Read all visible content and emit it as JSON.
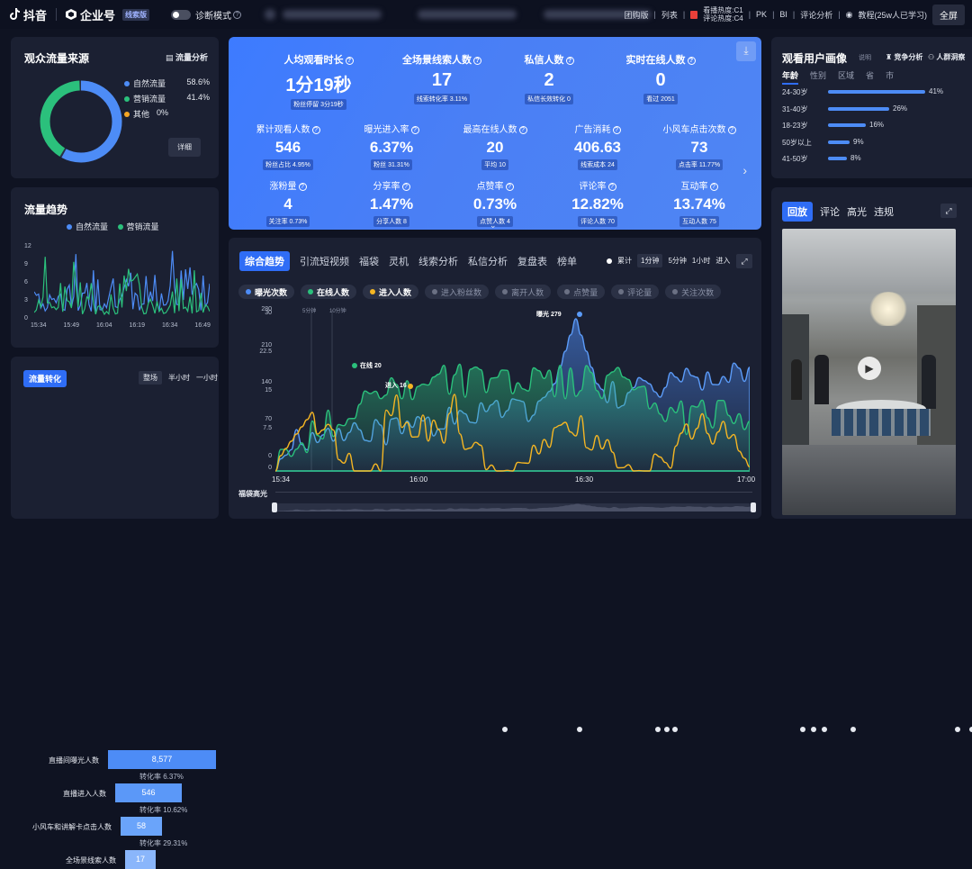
{
  "topbar": {
    "app_name": "抖音",
    "brand": "企业号",
    "brand_tag": "线索版",
    "diag_label": "诊断模式",
    "links": [
      "团购版",
      "列表"
    ],
    "heat_line1": "看播热度:C1",
    "heat_line2": "评论热度:C4",
    "links2": [
      "PK",
      "BI",
      "评论分析"
    ],
    "tutorial": "教程(25w人已学习)",
    "fullscreen": "全屏"
  },
  "source": {
    "title": "观众流量来源",
    "action": "流量分析",
    "detail_btn": "详细",
    "items": [
      {
        "label": "自然流量",
        "value": "58.6%",
        "color": "#4d8cf6"
      },
      {
        "label": "营销流量",
        "value": "41.4%",
        "color": "#2bc07c"
      },
      {
        "label": "其他",
        "value": "0%",
        "color": "#f5a623"
      }
    ],
    "shares": [
      58.6,
      41.4,
      0
    ]
  },
  "trend": {
    "title": "流量趋势",
    "legend": [
      {
        "name": "自然流量",
        "color": "#4d8cf6"
      },
      {
        "name": "营销流量",
        "color": "#2bc07c"
      }
    ],
    "y_ticks": [
      "12",
      "9",
      "6",
      "3",
      "0"
    ],
    "x_ticks": [
      "15:34",
      "15:49",
      "16:04",
      "16:19",
      "16:34",
      "16:49"
    ]
  },
  "funnel": {
    "title": "流量转化",
    "tabs": [
      "整场",
      "半小时",
      "一小时"
    ],
    "rows": [
      {
        "label": "直播间曝光人数",
        "value": "8,577",
        "share": 1.0
      },
      {
        "label": "直播进入人数",
        "value": "546",
        "share": 0.62
      },
      {
        "label": "小风车和讲解卡点击人数",
        "value": "58",
        "share": 0.38
      },
      {
        "label": "全场景线索人数",
        "value": "17",
        "share": 0.28
      }
    ],
    "rates": [
      "转化率 6.37%",
      "转化率 10.62%",
      "转化率 29.31%"
    ]
  },
  "kpi": {
    "big": [
      {
        "label": "人均观看时长",
        "value": "1分19秒",
        "sub": "粉丝停留 3分19秒"
      },
      {
        "label": "全场景线索人数",
        "value": "17",
        "sub": "线索转化率 3.11%"
      },
      {
        "label": "私信人数",
        "value": "2",
        "sub": "私信长效转化 0"
      },
      {
        "label": "实时在线人数",
        "value": "0",
        "sub": "看过 2051"
      }
    ],
    "row2": [
      {
        "label": "累计观看人数",
        "value": "546",
        "sub": "粉丝占比 4.95%"
      },
      {
        "label": "曝光进入率",
        "value": "6.37%",
        "sub": "粉丝 31.31%"
      },
      {
        "label": "最高在线人数",
        "value": "20",
        "sub": "平均 10"
      },
      {
        "label": "广告消耗",
        "value": "406.63",
        "sub": "线索成本 24"
      },
      {
        "label": "小风车点击次数",
        "value": "73",
        "sub": "点击率 11.77%"
      }
    ],
    "row3": [
      {
        "label": "涨粉量",
        "value": "4",
        "sub": "关注率 0.73%"
      },
      {
        "label": "分享率",
        "value": "1.47%",
        "sub": "分享人数 8"
      },
      {
        "label": "点赞率",
        "value": "0.73%",
        "sub": "点赞人数 4"
      },
      {
        "label": "评论率",
        "value": "12.82%",
        "sub": "评论人数 70"
      },
      {
        "label": "互动率",
        "value": "13.74%",
        "sub": "互动人数 75"
      }
    ]
  },
  "main": {
    "tabs": [
      "综合趋势",
      "引流短视频",
      "福袋",
      "灵机",
      "线索分析",
      "私信分析",
      "复盘表",
      "榜单"
    ],
    "mode_label": "累计",
    "intervals": [
      "1分钟",
      "5分钟",
      "1小时",
      "进入"
    ],
    "metrics": [
      {
        "label": "曝光次数",
        "color": "#4d8cf6",
        "on": true
      },
      {
        "label": "在线人数",
        "color": "#2bc07c",
        "on": true
      },
      {
        "label": "进入人数",
        "color": "#f5b623",
        "on": true
      },
      {
        "label": "进入粉丝数",
        "color": "#6b7184",
        "on": false
      },
      {
        "label": "离开人数",
        "color": "#6b7184",
        "on": false
      },
      {
        "label": "点赞量",
        "color": "#6b7184",
        "on": false
      },
      {
        "label": "评论量",
        "color": "#6b7184",
        "on": false
      },
      {
        "label": "关注次数",
        "color": "#6b7184",
        "on": false
      }
    ],
    "y_left": [
      "30",
      "22.5",
      "15",
      "7.5",
      "0"
    ],
    "y_right": [
      "280",
      "210",
      "140",
      "70",
      "0"
    ],
    "x_ticks": [
      "15:34",
      "16:00",
      "16:30",
      "17:00"
    ],
    "markers": [
      "5分钟",
      "10分钟"
    ],
    "annotations": [
      "曝光 279",
      "在线 20",
      "进入 16"
    ],
    "slider_label": "福袋高光"
  },
  "audience": {
    "title": "观看用户画像",
    "note": "说明",
    "competitor": "竞争分析",
    "crowd": "人群洞察",
    "tabs": [
      "年龄",
      "性别",
      "区域",
      "省",
      "市"
    ],
    "ages": [
      {
        "label": "24-30岁",
        "value": "41%",
        "pct": 41
      },
      {
        "label": "31-40岁",
        "value": "26%",
        "pct": 26
      },
      {
        "label": "18-23岁",
        "value": "16%",
        "pct": 16
      },
      {
        "label": "50岁以上",
        "value": "9%",
        "pct": 9
      },
      {
        "label": "41-50岁",
        "value": "8%",
        "pct": 8
      }
    ]
  },
  "replay": {
    "tabs": [
      "回放",
      "评论",
      "高光",
      "违规"
    ]
  }
}
